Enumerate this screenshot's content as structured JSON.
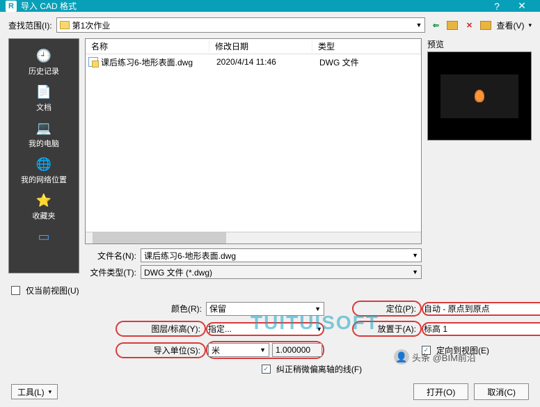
{
  "title": "导入 CAD 格式",
  "lookIn": {
    "label": "查找范围(I):",
    "value": "第1次作业"
  },
  "nav": {
    "view": "查看(V)"
  },
  "cols": {
    "name": "名称",
    "date": "修改日期",
    "type": "类型"
  },
  "file": {
    "name": "课后练习6-地形表面.dwg",
    "date": "2020/4/14 11:46",
    "type": "DWG 文件"
  },
  "sidebar": {
    "history": "历史记录",
    "docs": "文档",
    "mypc": "我的电脑",
    "network": "我的网络位置",
    "fav": "收藏夹"
  },
  "filename": {
    "label": "文件名(N):",
    "value": "课后练习6-地形表面.dwg"
  },
  "filetype": {
    "label": "文件类型(T):",
    "value": "DWG 文件 (*.dwg)"
  },
  "previewLabel": "预览",
  "onlyCurrentView": "仅当前视图(U)",
  "color": {
    "label": "颜色(R):",
    "value": "保留"
  },
  "layer": {
    "label": "图层/标高(Y):",
    "value": "指定..."
  },
  "unit": {
    "label": "导入单位(S):",
    "value": "米",
    "factor": "1.000000"
  },
  "placement": {
    "label": "定位(P):",
    "value": "自动 - 原点到原点"
  },
  "placeAt": {
    "label": "放置于(A):",
    "value": "标高 1"
  },
  "orient": "定向到视图(E)",
  "correct": "纠正稍微偏离轴的线(F)",
  "tools": "工具(L)",
  "open": "打开(O)",
  "cancel": "取消(C)",
  "wm1": "TUITUISOFT",
  "wm2": "头条 @BIM前沿"
}
